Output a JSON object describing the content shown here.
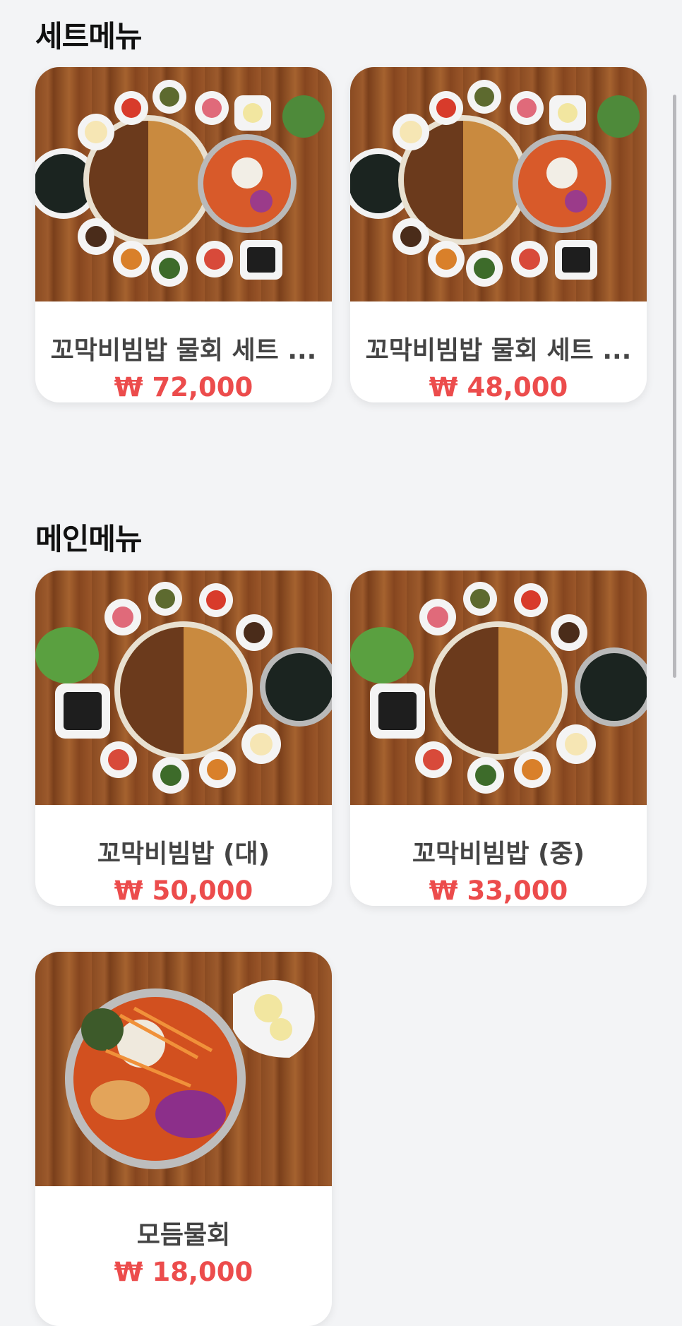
{
  "sections": [
    {
      "title": "세트메뉴",
      "items": [
        {
          "name": "꼬막비빔밥 물회 세트 ...",
          "price": "₩ 72,000",
          "photo_icon": "bibimbap-set-photo"
        },
        {
          "name": "꼬막비빔밥 물회 세트 ...",
          "price": "₩ 48,000",
          "photo_icon": "bibimbap-set-photo"
        }
      ]
    },
    {
      "title": "메인메뉴",
      "items": [
        {
          "name": "꼬막비빔밥 (대)",
          "price": "₩ 50,000",
          "photo_icon": "bibimbap-platter-photo"
        },
        {
          "name": "꼬막비빔밥 (중)",
          "price": "₩ 33,000",
          "photo_icon": "bibimbap-platter-photo"
        },
        {
          "name": "모듬물회",
          "price": "₩ 18,000",
          "photo_icon": "mulhoe-bowl-photo"
        }
      ]
    }
  ],
  "colors": {
    "background": "#f3f4f6",
    "price": "#ec4c4c",
    "title": "#111111",
    "item_name": "#444444"
  }
}
